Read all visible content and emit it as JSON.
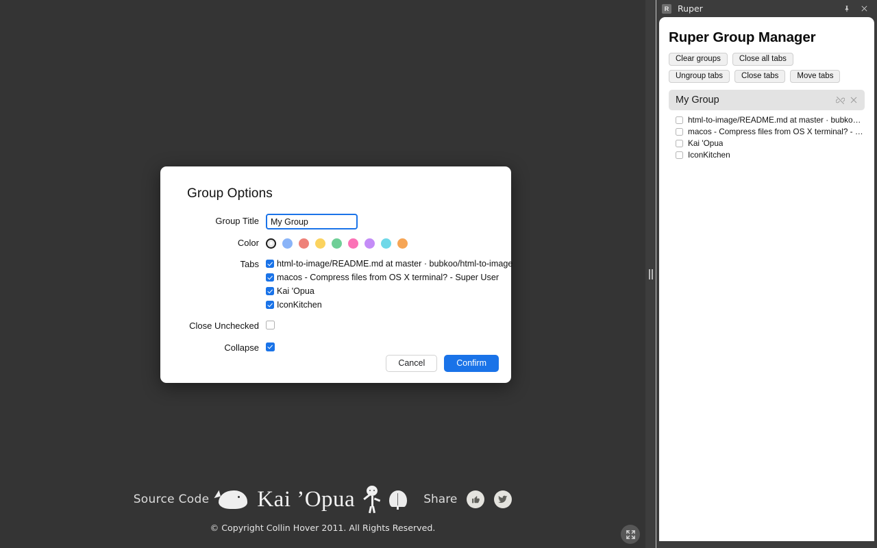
{
  "panel": {
    "titlebar": {
      "ext_badge": "R",
      "title": "Ruper",
      "pin_icon": "pin-icon",
      "close_icon": "close-icon"
    },
    "heading": "Ruper Group Manager",
    "buttons_row1": [
      {
        "label": "Clear groups"
      },
      {
        "label": "Close all tabs"
      }
    ],
    "buttons_row2": [
      {
        "label": "Ungroup tabs"
      },
      {
        "label": "Close tabs"
      },
      {
        "label": "Move tabs"
      }
    ],
    "group": {
      "name": "My Group",
      "ungroup_icon": "unlink-icon",
      "close_icon": "close-icon",
      "tabs": [
        {
          "label": "html-to-image/README.md at master · bubkoo/html-t...",
          "checked": false
        },
        {
          "label": "macos - Compress files from OS X terminal? - Super ...",
          "checked": false
        },
        {
          "label": "Kai 'Opua",
          "checked": false
        },
        {
          "label": "IconKitchen",
          "checked": false
        }
      ]
    }
  },
  "modal": {
    "title": "Group Options",
    "fields": {
      "group_title_label": "Group Title",
      "group_title_value": "My Group",
      "group_title_placeholder": "Group Title",
      "color_label": "Color",
      "tabs_label": "Tabs",
      "close_unchecked_label": "Close Unchecked",
      "collapse_label": "Collapse"
    },
    "colors": [
      {
        "name": "grey",
        "hex": "#e8e8e8",
        "selected": true
      },
      {
        "name": "blue",
        "hex": "#8ab4f8",
        "selected": false
      },
      {
        "name": "red",
        "hex": "#ee8179",
        "selected": false
      },
      {
        "name": "yellow",
        "hex": "#fbd35f",
        "selected": false
      },
      {
        "name": "green",
        "hex": "#6fcf97",
        "selected": false
      },
      {
        "name": "pink",
        "hex": "#fb72b6",
        "selected": false
      },
      {
        "name": "purple",
        "hex": "#c48cf7",
        "selected": false
      },
      {
        "name": "cyan",
        "hex": "#6fd8e8",
        "selected": false
      },
      {
        "name": "orange",
        "hex": "#f6a555",
        "selected": false
      }
    ],
    "tabs": [
      {
        "label": "html-to-image/README.md at master · bubkoo/html-to-image",
        "checked": true
      },
      {
        "label": "macos - Compress files from OS X terminal? - Super User",
        "checked": true
      },
      {
        "label": "Kai 'Opua",
        "checked": true
      },
      {
        "label": "IconKitchen",
        "checked": true
      }
    ],
    "close_unchecked_checked": false,
    "collapse_checked": true,
    "cancel_label": "Cancel",
    "confirm_label": "Confirm",
    "accent_color": "#1a73e8"
  },
  "footer": {
    "source_code_label": "Source Code",
    "brand": "Kai ’Opua",
    "share_label": "Share",
    "share_buttons": [
      {
        "icon": "thumbs-up-icon"
      },
      {
        "icon": "twitter-bird-icon"
      }
    ],
    "copyright": "© Copyright Collin Hover 2011. All Rights Reserved."
  },
  "fullscreen_icon": "fullscreen-expand-icon",
  "drag_handle": "panel-resize-handle"
}
